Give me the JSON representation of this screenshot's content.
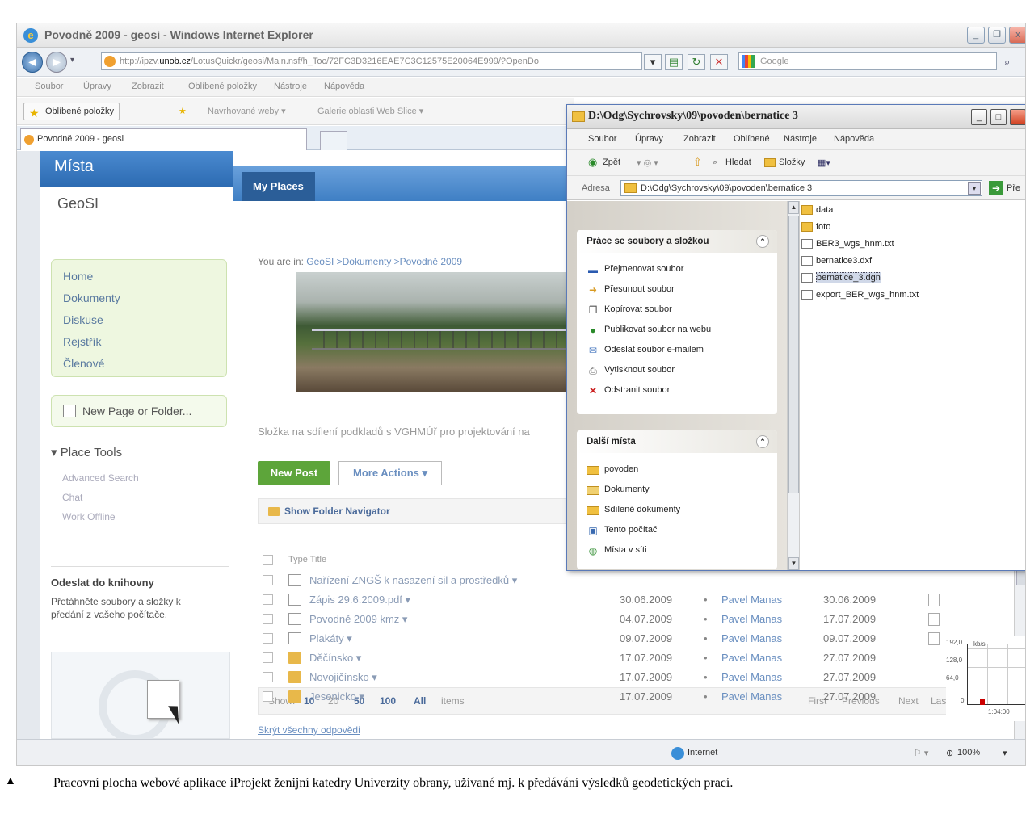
{
  "ie": {
    "title": "Povodně 2009 - geosi - Windows Internet Explorer",
    "url_pre": "http://ipzv.",
    "url_domain": "unob.cz",
    "url_post": "/LotusQuickr/geosi/Main.nsf/h_Toc/72FC3D3216EAE7C3C12575E20064E999/?OpenDo",
    "search_placeholder": "Google",
    "menu": [
      "Soubor",
      "Úpravy",
      "Zobrazit",
      "Oblíbené položky",
      "Nástroje",
      "Nápověda"
    ],
    "favorites_button": "Oblíbené položky",
    "fav_links": [
      "Navrhované weby ▾",
      "Galerie oblasti Web Slice ▾"
    ],
    "tab_title": "Povodně 2009 - geosi"
  },
  "site": {
    "misto_label": "Místa",
    "my_places": "My Places",
    "place_name": "GeoSI",
    "nav": [
      "Home",
      "Dokumenty",
      "Diskuse",
      "Rejstřík",
      "Členové"
    ],
    "new_page": "New Page or Folder...",
    "place_tools": "▾ Place Tools",
    "tools": [
      "Advanced Search",
      "Chat",
      "Work Offline"
    ],
    "odeslat_title": "Odeslat do knihovny",
    "odeslat_text": "Přetáhněte soubory a složky k předání z vašeho počítače."
  },
  "main": {
    "you_are_in": "You are in:",
    "crumbs": "GeoSI >Dokumenty >Povodně 2009",
    "description": "Složka na sdílení podkladů s VGHMÚř pro projektování na",
    "new_post": "New Post",
    "more_actions": "More Actions ▾",
    "show_folder_nav": "Show Folder Navigator",
    "type_title": "Type Title",
    "rows": [
      {
        "title": "Nařízení ZNGŠ k nasazení sil a prostředků ▾",
        "type": "doc",
        "date1": "",
        "author": "",
        "date2": ""
      },
      {
        "title": "Zápis 29.6.2009.pdf ▾",
        "type": "doc",
        "date1": "30.06.2009",
        "author": "Pavel Manas",
        "date2": "30.06.2009"
      },
      {
        "title": "Povodně 2009 kmz ▾",
        "type": "doc",
        "date1": "04.07.2009",
        "author": "Pavel Manas",
        "date2": "17.07.2009"
      },
      {
        "title": "Plakáty ▾",
        "type": "doc",
        "date1": "09.07.2009",
        "author": "Pavel Manas",
        "date2": "09.07.2009"
      },
      {
        "title": "Děčínsko ▾",
        "type": "folder",
        "date1": "17.07.2009",
        "author": "Pavel Manas",
        "date2": "27.07.2009"
      },
      {
        "title": "Novojičínsko ▾",
        "type": "folder",
        "date1": "17.07.2009",
        "author": "Pavel Manas",
        "date2": "27.07.2009"
      },
      {
        "title": "Jesenicko ▾",
        "type": "folder",
        "date1": "17.07.2009",
        "author": "Pavel Manas",
        "date2": "27.07.2009"
      }
    ],
    "show_label": "Show:",
    "page_sizes": [
      "10",
      "20",
      "50",
      "100",
      "All"
    ],
    "items_label": "items",
    "pager": [
      "First",
      "Previous",
      "Next",
      "Last"
    ],
    "skryt": "Skrýt všechny odpovědi",
    "mini_chart_ticks": [
      "192,0",
      "128,0",
      "64,0",
      "0"
    ],
    "mini_chart_unit": "kb/s",
    "mini_chart_time": "1:04:00"
  },
  "status": {
    "zone": "Internet",
    "zoom": "100%"
  },
  "explorer": {
    "title": "D:\\Odg\\Sychrovsky\\09\\povoden\\bernatice 3",
    "menu": [
      "Soubor",
      "Úpravy",
      "Zobrazit",
      "Oblíbené",
      "Nástroje",
      "Nápověda"
    ],
    "back": "Zpět",
    "search": "Hledat",
    "folders": "Složky",
    "address_label": "Adresa",
    "address": "D:\\Odg\\Sychrovsky\\09\\povoden\\bernatice 3",
    "go_label": "Pře",
    "tasks_title": "Práce se soubory a složkou",
    "tasks": [
      "Přejmenovat soubor",
      "Přesunout soubor",
      "Kopírovat soubor",
      "Publikovat soubor na webu",
      "Odeslat soubor e-mailem",
      "Vytisknout soubor",
      "Odstranit soubor"
    ],
    "places_title": "Další místa",
    "places": [
      "povoden",
      "Dokumenty",
      "Sdílené dokumenty",
      "Tento počítač",
      "Místa v síti"
    ],
    "files": [
      {
        "name": "data",
        "kind": "folder"
      },
      {
        "name": "foto",
        "kind": "folder"
      },
      {
        "name": "BER3_wgs_hnm.txt",
        "kind": "text"
      },
      {
        "name": "bernatice3.dxf",
        "kind": "text"
      },
      {
        "name": "bernatice_3.dgn",
        "kind": "text",
        "selected": true
      },
      {
        "name": "export_BER_wgs_hnm.txt",
        "kind": "text"
      }
    ]
  },
  "caption": {
    "text": "Pracovní plocha webové aplikace iProjekt ženijní katedry Univerzity obrany, užívané mj. k předávání výsledků geodetických prací."
  },
  "colors": {
    "accent": "#3f7fc4",
    "green": "#5da53a",
    "link": "#6a8fc0"
  }
}
